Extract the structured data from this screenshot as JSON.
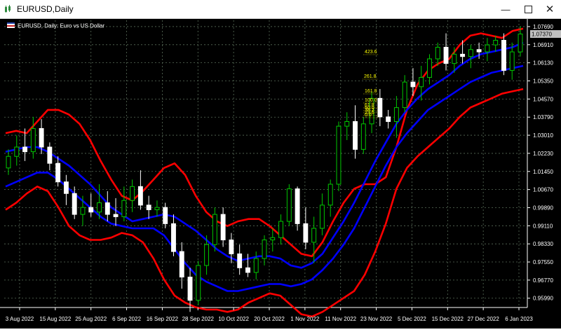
{
  "window": {
    "title": "EURUSD,Daily",
    "minimize_icon": "minimize-icon",
    "maximize_icon": "maximize-icon",
    "close_icon": "close-icon"
  },
  "chart": {
    "header": "EURUSD, Daily: Euro vs US Dollar",
    "current_price": "1.07370"
  },
  "colors": {
    "background": "#000000",
    "grid": "#5a6e5a",
    "axis_text": "#ffffff",
    "bull_candle": "#00c800",
    "bear_candle": "#ffffff",
    "outer_band": "#ff0000",
    "inner_band": "#0000ff",
    "fib_text": "#ffff00",
    "price_marker": "#c0c0c0"
  },
  "chart_data": {
    "type": "candlestick",
    "title": "EURUSD, Daily: Euro vs US Dollar",
    "y_ticks": [
      "1.07690",
      "1.06910",
      "1.06130",
      "1.05350",
      "1.04570",
      "1.03790",
      "1.03010",
      "1.02230",
      "1.01450",
      "1.00670",
      "0.99890",
      "0.99110",
      "0.98330",
      "0.97550",
      "0.96770",
      "0.95990"
    ],
    "ylim": [
      0.9559,
      1.0796
    ],
    "x_ticks": [
      "3 Aug 2022",
      "15 Aug 2022",
      "25 Aug 2022",
      "6 Sep 2022",
      "16 Sep 2022",
      "28 Sep 2022",
      "10 Oct 2022",
      "20 Oct 2022",
      "1 Nov 2022",
      "11 Nov 2022",
      "23 Nov 2022",
      "5 Dec 2022",
      "15 Dec 2022",
      "27 Dec 2022",
      "6 Jan 2023"
    ],
    "last_price": 1.0737,
    "fibonacci_labels": [
      "423.6",
      "261.8",
      "161.8",
      "100.0",
      "61.8",
      "50.0",
      "38.2",
      "23.6",
      "0.0"
    ],
    "band_series": [
      {
        "name": "outer-upper",
        "color": "#ff0000",
        "values": [
          1.031,
          1.032,
          1.031,
          1.036,
          1.041,
          1.041,
          1.039,
          1.035,
          1.028,
          1.019,
          1.011,
          1.004,
          1.002,
          1.006,
          1.011,
          1.016,
          1.018,
          1.013,
          1.004,
          0.997,
          0.993,
          0.991,
          0.993,
          0.994,
          0.994,
          0.991,
          0.987,
          0.983,
          0.979,
          0.978,
          0.984,
          0.993,
          1.001,
          1.007,
          1.009,
          1.009,
          1.012,
          1.025,
          1.041,
          1.052,
          1.058,
          1.061,
          1.063,
          1.069,
          1.073,
          1.074,
          1.073,
          1.072,
          1.075,
          1.076
        ]
      },
      {
        "name": "inner-upper",
        "color": "#0000ff",
        "values": [
          1.023,
          1.024,
          1.025,
          1.025,
          1.023,
          1.02,
          1.017,
          1.013,
          1.009,
          1.004,
          0.999,
          0.996,
          0.993,
          0.994,
          0.995,
          0.996,
          0.995,
          0.992,
          0.989,
          0.985,
          0.981,
          0.978,
          0.976,
          0.977,
          0.978,
          0.978,
          0.977,
          0.974,
          0.973,
          0.975,
          0.979,
          0.986,
          0.993,
          1.001,
          1.01,
          1.019,
          1.027,
          1.035,
          1.041,
          1.046,
          1.05,
          1.053,
          1.056,
          1.06,
          1.063,
          1.065,
          1.066,
          1.067,
          1.068,
          1.07
        ]
      },
      {
        "name": "inner-lower",
        "color": "#0000ff",
        "values": [
          1.008,
          1.01,
          1.012,
          1.014,
          1.014,
          1.011,
          1.007,
          1.003,
          0.999,
          0.995,
          0.992,
          0.991,
          0.99,
          0.99,
          0.99,
          0.987,
          0.981,
          0.975,
          0.97,
          0.967,
          0.965,
          0.963,
          0.963,
          0.964,
          0.965,
          0.966,
          0.966,
          0.965,
          0.966,
          0.968,
          0.972,
          0.977,
          0.983,
          0.99,
          0.999,
          1.008,
          1.017,
          1.025,
          1.031,
          1.036,
          1.041,
          1.044,
          1.047,
          1.05,
          1.053,
          1.055,
          1.057,
          1.058,
          1.059,
          1.06
        ]
      },
      {
        "name": "outer-lower",
        "color": "#ff0000",
        "values": [
          0.998,
          1.001,
          1.005,
          1.008,
          1.006,
          0.999,
          0.991,
          0.987,
          0.985,
          0.985,
          0.986,
          0.988,
          0.987,
          0.984,
          0.977,
          0.968,
          0.961,
          0.958,
          0.956,
          0.955,
          0.955,
          0.954,
          0.955,
          0.958,
          0.96,
          0.962,
          0.961,
          0.957,
          0.953,
          0.952,
          0.954,
          0.957,
          0.96,
          0.963,
          0.97,
          0.98,
          0.992,
          1.007,
          1.016,
          1.021,
          1.025,
          1.029,
          1.033,
          1.038,
          1.042,
          1.044,
          1.046,
          1.048,
          1.049,
          1.05
        ]
      }
    ],
    "candles": [
      {
        "o": 1.016,
        "h": 1.024,
        "l": 1.013,
        "c": 1.021
      },
      {
        "o": 1.021,
        "h": 1.03,
        "l": 1.017,
        "c": 1.025
      },
      {
        "o": 1.025,
        "h": 1.033,
        "l": 1.019,
        "c": 1.023
      },
      {
        "o": 1.023,
        "h": 1.038,
        "l": 1.02,
        "c": 1.033
      },
      {
        "o": 1.033,
        "h": 1.037,
        "l": 1.022,
        "c": 1.025
      },
      {
        "o": 1.025,
        "h": 1.027,
        "l": 1.015,
        "c": 1.018
      },
      {
        "o": 1.018,
        "h": 1.021,
        "l": 1.008,
        "c": 1.01
      },
      {
        "o": 1.01,
        "h": 1.013,
        "l": 1.0,
        "c": 1.005
      },
      {
        "o": 1.005,
        "h": 1.008,
        "l": 0.994,
        "c": 0.996
      },
      {
        "o": 0.996,
        "h": 1.004,
        "l": 0.991,
        "c": 0.999
      },
      {
        "o": 0.999,
        "h": 1.005,
        "l": 0.995,
        "c": 0.997
      },
      {
        "o": 0.997,
        "h": 1.009,
        "l": 0.994,
        "c": 1.001
      },
      {
        "o": 1.001,
        "h": 1.006,
        "l": 0.993,
        "c": 0.996
      },
      {
        "o": 0.996,
        "h": 1.003,
        "l": 0.991,
        "c": 0.995
      },
      {
        "o": 0.995,
        "h": 1.008,
        "l": 0.993,
        "c": 1.002
      },
      {
        "o": 1.002,
        "h": 1.011,
        "l": 0.997,
        "c": 1.008
      },
      {
        "o": 1.008,
        "h": 1.015,
        "l": 0.998,
        "c": 1.0
      },
      {
        "o": 1.0,
        "h": 1.004,
        "l": 0.994,
        "c": 0.998
      },
      {
        "o": 0.998,
        "h": 1.002,
        "l": 0.995,
        "c": 0.999
      },
      {
        "o": 0.999,
        "h": 1.001,
        "l": 0.99,
        "c": 0.992
      },
      {
        "o": 0.992,
        "h": 0.996,
        "l": 0.978,
        "c": 0.98
      },
      {
        "o": 0.98,
        "h": 0.984,
        "l": 0.964,
        "c": 0.969
      },
      {
        "o": 0.969,
        "h": 0.973,
        "l": 0.954,
        "c": 0.959
      },
      {
        "o": 0.959,
        "h": 0.976,
        "l": 0.957,
        "c": 0.974
      },
      {
        "o": 0.974,
        "h": 0.987,
        "l": 0.97,
        "c": 0.983
      },
      {
        "o": 0.983,
        "h": 0.999,
        "l": 0.98,
        "c": 0.996
      },
      {
        "o": 0.996,
        "h": 0.999,
        "l": 0.982,
        "c": 0.985
      },
      {
        "o": 0.985,
        "h": 0.988,
        "l": 0.975,
        "c": 0.979
      },
      {
        "o": 0.979,
        "h": 0.983,
        "l": 0.97,
        "c": 0.973
      },
      {
        "o": 0.973,
        "h": 0.979,
        "l": 0.969,
        "c": 0.971
      },
      {
        "o": 0.971,
        "h": 0.98,
        "l": 0.968,
        "c": 0.977
      },
      {
        "o": 0.977,
        "h": 0.987,
        "l": 0.974,
        "c": 0.985
      },
      {
        "o": 0.985,
        "h": 0.99,
        "l": 0.98,
        "c": 0.986
      },
      {
        "o": 0.986,
        "h": 0.996,
        "l": 0.983,
        "c": 0.993
      },
      {
        "o": 0.993,
        "h": 1.009,
        "l": 0.991,
        "c": 1.007
      },
      {
        "o": 1.007,
        "h": 1.008,
        "l": 0.989,
        "c": 0.992
      },
      {
        "o": 0.992,
        "h": 0.999,
        "l": 0.981,
        "c": 0.984
      },
      {
        "o": 0.984,
        "h": 0.995,
        "l": 0.975,
        "c": 0.99
      },
      {
        "o": 0.99,
        "h": 1.005,
        "l": 0.987,
        "c": 1.0
      },
      {
        "o": 1.0,
        "h": 1.011,
        "l": 0.995,
        "c": 1.009
      },
      {
        "o": 1.009,
        "h": 1.036,
        "l": 1.006,
        "c": 1.034
      },
      {
        "o": 1.034,
        "h": 1.04,
        "l": 1.028,
        "c": 1.036
      },
      {
        "o": 1.036,
        "h": 1.043,
        "l": 1.02,
        "c": 1.024
      },
      {
        "o": 1.024,
        "h": 1.038,
        "l": 1.022,
        "c": 1.035
      },
      {
        "o": 1.035,
        "h": 1.049,
        "l": 1.031,
        "c": 1.046
      },
      {
        "o": 1.046,
        "h": 1.05,
        "l": 1.034,
        "c": 1.038
      },
      {
        "o": 1.038,
        "h": 1.041,
        "l": 1.033,
        "c": 1.036
      },
      {
        "o": 1.036,
        "h": 1.047,
        "l": 1.029,
        "c": 1.042
      },
      {
        "o": 1.042,
        "h": 1.056,
        "l": 1.04,
        "c": 1.053
      },
      {
        "o": 1.053,
        "h": 1.059,
        "l": 1.047,
        "c": 1.051
      },
      {
        "o": 1.051,
        "h": 1.06,
        "l": 1.045,
        "c": 1.055
      },
      {
        "o": 1.055,
        "h": 1.065,
        "l": 1.052,
        "c": 1.063
      },
      {
        "o": 1.063,
        "h": 1.07,
        "l": 1.06,
        "c": 1.068
      },
      {
        "o": 1.068,
        "h": 1.074,
        "l": 1.058,
        "c": 1.061
      },
      {
        "o": 1.061,
        "h": 1.068,
        "l": 1.057,
        "c": 1.065
      },
      {
        "o": 1.065,
        "h": 1.071,
        "l": 1.061,
        "c": 1.064
      },
      {
        "o": 1.064,
        "h": 1.069,
        "l": 1.059,
        "c": 1.067
      },
      {
        "o": 1.067,
        "h": 1.07,
        "l": 1.063,
        "c": 1.066
      },
      {
        "o": 1.066,
        "h": 1.072,
        "l": 1.062,
        "c": 1.069
      },
      {
        "o": 1.069,
        "h": 1.073,
        "l": 1.066,
        "c": 1.071
      },
      {
        "o": 1.071,
        "h": 1.074,
        "l": 1.056,
        "c": 1.058
      },
      {
        "o": 1.058,
        "h": 1.07,
        "l": 1.054,
        "c": 1.066
      },
      {
        "o": 1.066,
        "h": 1.077,
        "l": 1.064,
        "c": 1.0737
      }
    ]
  }
}
